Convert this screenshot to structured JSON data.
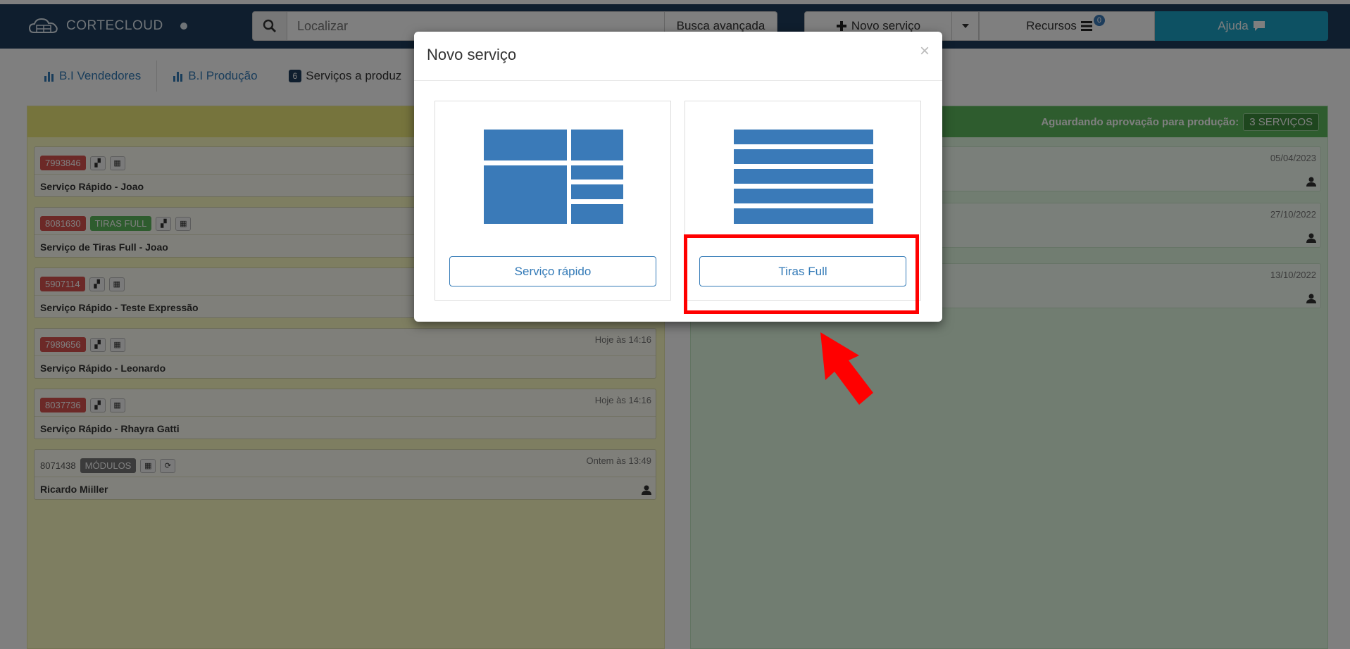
{
  "navbar": {
    "brand": "CORTECLOUD",
    "search_placeholder": "Localizar",
    "search_advanced": "Busca avançada",
    "novo_servico": "Novo serviço",
    "recursos": "Recursos",
    "recursos_badge": "0",
    "ajuda": "Ajuda"
  },
  "tabs": [
    {
      "label": "B.I Vendedores",
      "icon": "bar-chart-icon"
    },
    {
      "label": "B.I Produção",
      "icon": "bar-chart-icon"
    },
    {
      "count": "6",
      "label": "Serviços a produz"
    }
  ],
  "left_cards": [
    {
      "id": "7993846",
      "tag": "",
      "title": "Serviço Rápido - Joao",
      "time": ""
    },
    {
      "id": "8081630",
      "tag": "TIRAS FULL",
      "title": "Serviço de Tiras Full - Joao",
      "time": ""
    },
    {
      "id": "5907114",
      "tag": "",
      "title": "Serviço Rápido - Teste Expressão",
      "time": ""
    },
    {
      "id": "7989656",
      "tag": "",
      "title": "Serviço Rápido - Leonardo",
      "time": "Hoje às 14:16"
    },
    {
      "id": "8037736",
      "tag": "",
      "title": "Serviço Rápido - Rhayra Gatti",
      "time": "Hoje às 14:16"
    },
    {
      "id": "8071438",
      "tag": "MÓDULOS",
      "title": "Ricardo Miiller",
      "time": "Ontem às 13:49"
    }
  ],
  "right_panel": {
    "header_label": "Aguardando aprovação para produção:",
    "header_badge": "3 SERVIÇOS",
    "cards": [
      {
        "date": "05/04/2023"
      },
      {
        "date": "27/10/2022"
      },
      {
        "date": "13/10/2022"
      }
    ]
  },
  "modal": {
    "title": "Novo serviço",
    "close": "×",
    "option_left": "Serviço rápido",
    "option_right": "Tiras Full"
  },
  "colors": {
    "navbar": "#1f3d5c",
    "accent": "#337ab7",
    "highlight": "#ff0000"
  }
}
